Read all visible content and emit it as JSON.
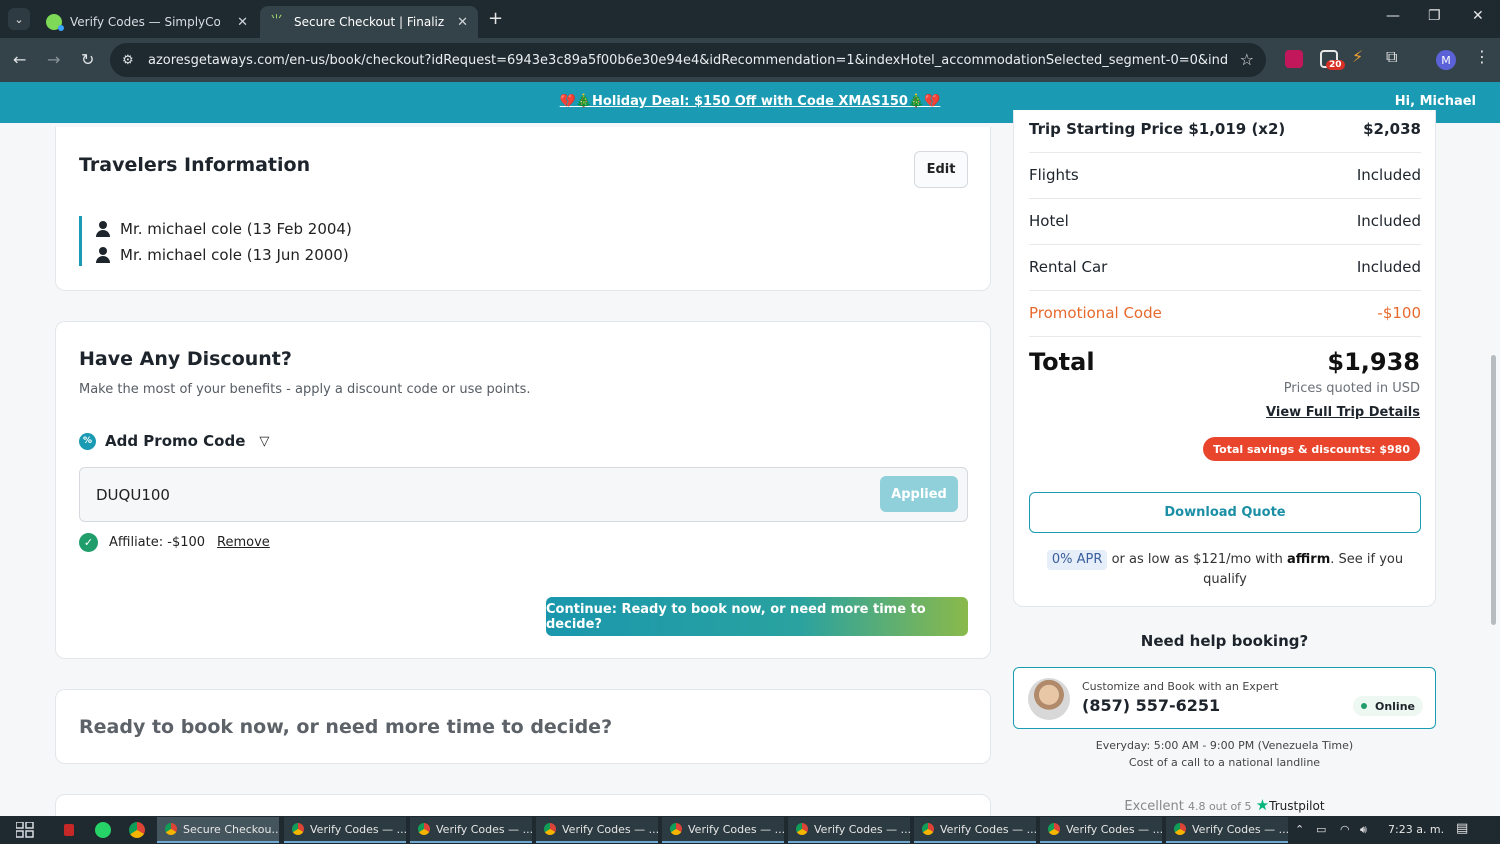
{
  "browser": {
    "tabs": [
      {
        "title": "Verify Codes — SimplyCodes"
      },
      {
        "title": "Secure Checkout | Finalize Your"
      }
    ],
    "url": "azoresgetaways.com/en-us/book/checkout?idRequest=6943e3c89a5f00b6e30e94e4&idRecommendation=1&indexHotel_accommodationSelected_segment-0=0&indexRecommendatio...",
    "extension_badge": "20",
    "profile_initial": "M"
  },
  "site": {
    "banner": "Holiday Deal: $150 Off with Code XMAS150",
    "banner_emoji_left": "💔🎄",
    "banner_emoji_right": "🎄💔",
    "greeting": "Hi, Michael"
  },
  "travelers": {
    "title": "Travelers Information",
    "edit_label": "Edit",
    "list": [
      "Mr. michael cole (13 Feb 2004)",
      "Mr. michael cole (13 Jun 2000)"
    ]
  },
  "discount": {
    "title": "Have Any Discount?",
    "subtitle": "Make the most of your benefits - apply a discount code or use points.",
    "toggle_label": "Add Promo Code",
    "code_value": "DUQU100",
    "applied_label": "Applied",
    "affiliate_text": "Affiliate: -$100",
    "remove_label": "Remove",
    "continue_label": "Continue: Ready to book now, or need more time to decide?"
  },
  "ready": {
    "title": "Ready to book now, or need more time to decide?"
  },
  "summary": {
    "rows": [
      {
        "label": "Trip Starting Price $1,019 (x2)",
        "value": "$2,038"
      },
      {
        "label": "Flights",
        "value": "Included"
      },
      {
        "label": "Hotel",
        "value": "Included"
      },
      {
        "label": "Rental Car",
        "value": "Included"
      },
      {
        "label": "Promotional Code",
        "value": "-$100"
      }
    ],
    "total_label": "Total",
    "total_value": "$1,938",
    "currency_note": "Prices quoted in USD",
    "details_link": "View Full Trip Details",
    "savings": "Total savings & discounts: $980",
    "download_label": "Download Quote",
    "apr_chip": "0% APR",
    "apr_text_1": "or as low as $121/mo with",
    "affirm": "affirm",
    "apr_text_2": ". See if you qualify"
  },
  "help": {
    "title": "Need help booking?",
    "expert_label": "Customize and Book with an Expert",
    "phone": "(857) 557-6251",
    "online": "Online",
    "hours": "Everyday: 5:00 AM - 9:00 PM (Venezuela Time)",
    "cost_note": "Cost of a call to a national landline",
    "tp_excellent": "Excellent",
    "tp_rating": "4.8 out of 5",
    "tp_brand": "Trustpilot"
  },
  "taskbar": {
    "tasks": [
      "Secure Checkou...",
      "Verify Codes — ...",
      "Verify Codes — ...",
      "Verify Codes — ...",
      "Verify Codes — ...",
      "Verify Codes — ...",
      "Verify Codes — ...",
      "Verify Codes — ...",
      "Verify Codes — ..."
    ],
    "clock": "7:23 a. m."
  },
  "colors": {
    "brand_teal": "#1a9bb3",
    "promo_orange": "#e8692c",
    "savings_red": "#e8452c",
    "success_green": "#1f9e6b"
  }
}
